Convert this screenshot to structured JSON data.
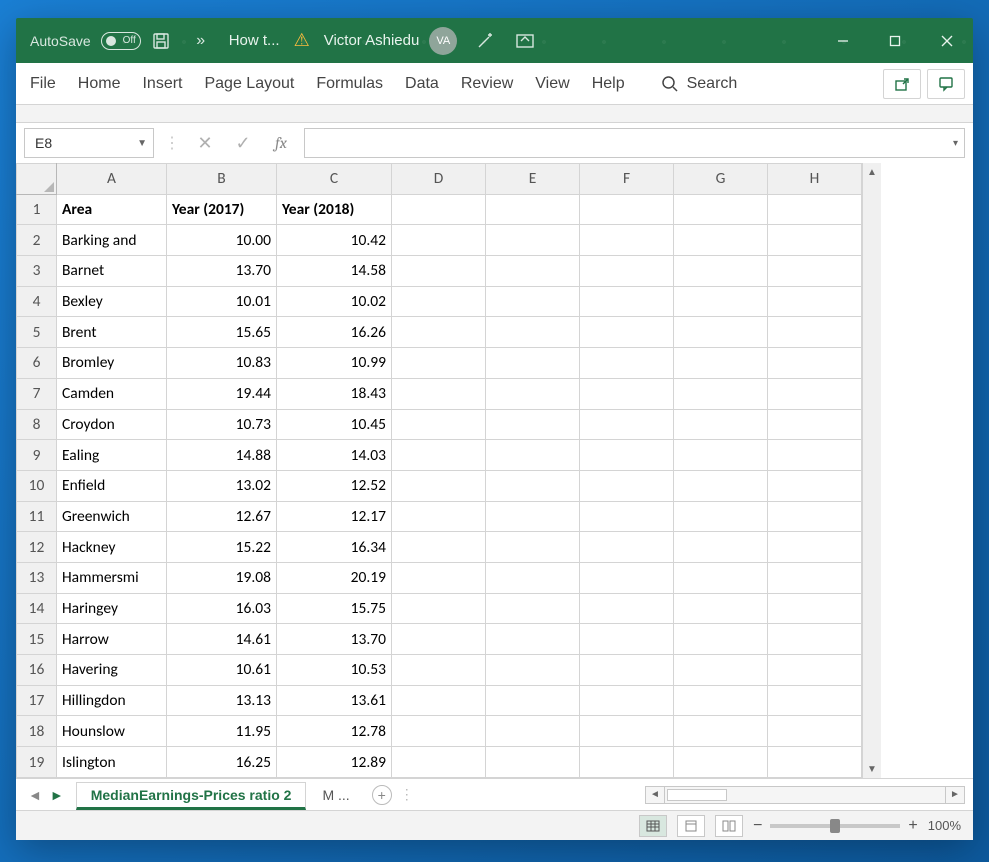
{
  "titlebar": {
    "autosave_label": "AutoSave",
    "autosave_state": "Off",
    "doc_title": "How t...",
    "user_name": "Victor Ashiedu",
    "user_initials": "VA"
  },
  "ribbon": {
    "tabs": [
      "File",
      "Home",
      "Insert",
      "Page Layout",
      "Formulas",
      "Data",
      "Review",
      "View",
      "Help"
    ],
    "search_label": "Search"
  },
  "formula": {
    "namebox": "E8",
    "fx_label": "fx",
    "value": ""
  },
  "sheet": {
    "columns": [
      "A",
      "B",
      "C",
      "D",
      "E",
      "F",
      "G",
      "H"
    ],
    "header_row": [
      "Area",
      "Year (2017)",
      "Year (2018)"
    ],
    "rows": [
      {
        "n": 2,
        "area": "Barking and",
        "y17": "10.00",
        "y18": "10.42"
      },
      {
        "n": 3,
        "area": "Barnet",
        "y17": "13.70",
        "y18": "14.58"
      },
      {
        "n": 4,
        "area": "Bexley",
        "y17": "10.01",
        "y18": "10.02"
      },
      {
        "n": 5,
        "area": "Brent",
        "y17": "15.65",
        "y18": "16.26"
      },
      {
        "n": 6,
        "area": "Bromley",
        "y17": "10.83",
        "y18": "10.99"
      },
      {
        "n": 7,
        "area": "Camden",
        "y17": "19.44",
        "y18": "18.43"
      },
      {
        "n": 8,
        "area": "Croydon",
        "y17": "10.73",
        "y18": "10.45"
      },
      {
        "n": 9,
        "area": "Ealing",
        "y17": "14.88",
        "y18": "14.03"
      },
      {
        "n": 10,
        "area": "Enfield",
        "y17": "13.02",
        "y18": "12.52"
      },
      {
        "n": 11,
        "area": "Greenwich",
        "y17": "12.67",
        "y18": "12.17"
      },
      {
        "n": 12,
        "area": "Hackney",
        "y17": "15.22",
        "y18": "16.34"
      },
      {
        "n": 13,
        "area": "Hammersmi",
        "y17": "19.08",
        "y18": "20.19"
      },
      {
        "n": 14,
        "area": "Haringey",
        "y17": "16.03",
        "y18": "15.75"
      },
      {
        "n": 15,
        "area": "Harrow",
        "y17": "14.61",
        "y18": "13.70"
      },
      {
        "n": 16,
        "area": "Havering",
        "y17": "10.61",
        "y18": "10.53"
      },
      {
        "n": 17,
        "area": "Hillingdon",
        "y17": "13.13",
        "y18": "13.61"
      },
      {
        "n": 18,
        "area": "Hounslow",
        "y17": "11.95",
        "y18": "12.78"
      },
      {
        "n": 19,
        "area": "Islington",
        "y17": "16.25",
        "y18": "12.89"
      }
    ]
  },
  "tabs": {
    "active": "MedianEarnings-Prices ratio 2",
    "inactive": "M ..."
  },
  "status": {
    "zoom": "100%"
  }
}
